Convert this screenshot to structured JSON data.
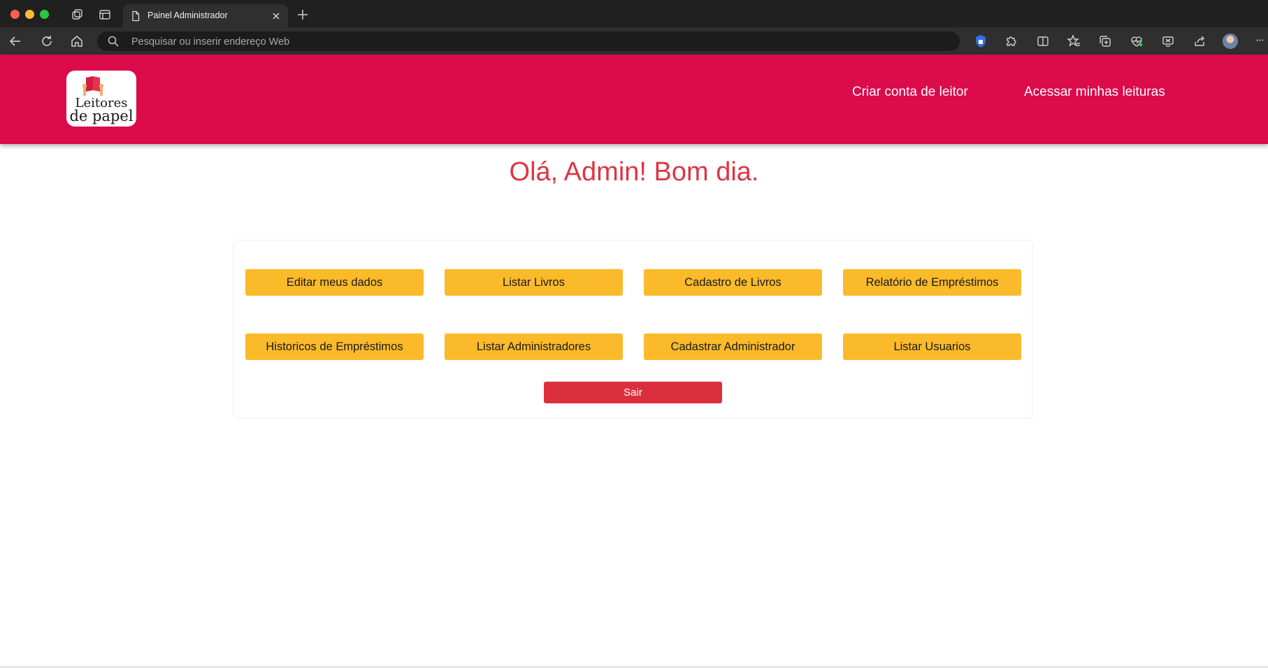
{
  "browser": {
    "tab_title": "Painel Administrador",
    "address_placeholder": "Pesquisar ou inserir endereço Web",
    "more_label": "···"
  },
  "header": {
    "logo_line1": "Leitores",
    "logo_line2": "de papel",
    "nav": [
      {
        "label": "Criar conta de leitor"
      },
      {
        "label": "Acessar minhas leituras"
      }
    ]
  },
  "main": {
    "greeting": "Olá, Admin! Bom dia.",
    "buttons": [
      {
        "label": "Editar meus dados"
      },
      {
        "label": "Listar Livros"
      },
      {
        "label": "Cadastro de Livros"
      },
      {
        "label": "Relatório de Empréstimos"
      },
      {
        "label": "Historicos de Empréstimos"
      },
      {
        "label": "Listar Administradores"
      },
      {
        "label": "Cadastrar Administrador"
      },
      {
        "label": "Listar Usuarios"
      }
    ],
    "exit_label": "Sair"
  },
  "colors": {
    "header": "#db0b4c",
    "greeting": "#dc3545",
    "button": "#fbba2a",
    "exit": "#dc2f3e"
  }
}
